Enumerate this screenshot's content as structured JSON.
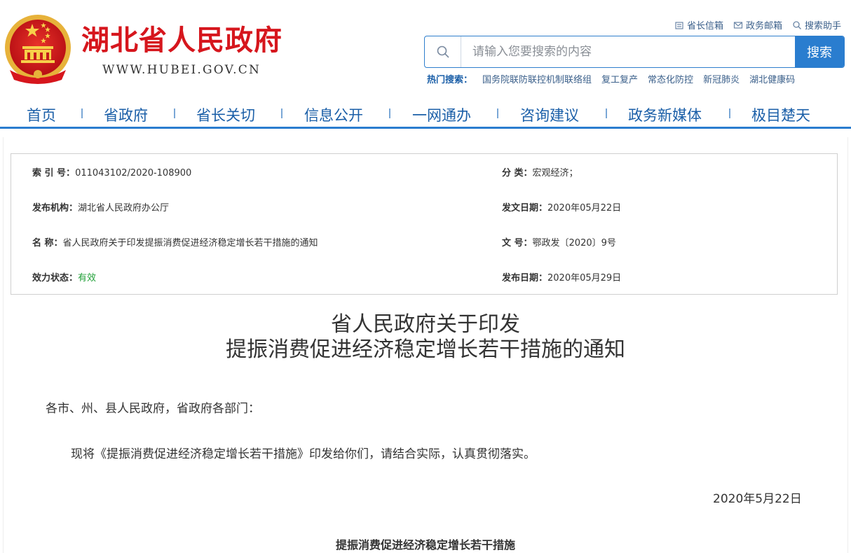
{
  "header": {
    "site_title": "湖北省人民政府",
    "site_url": "WWW.HUBEI.GOV.CN",
    "top_links": [
      {
        "label": "省长信箱",
        "icon": "mailbox-icon"
      },
      {
        "label": "政务邮箱",
        "icon": "envelope-icon"
      },
      {
        "label": "搜索助手",
        "icon": "search-icon"
      }
    ],
    "search": {
      "placeholder": "请输入您要搜索的内容",
      "button_label": "搜索"
    },
    "hot_search": {
      "label": "热门搜索：",
      "items": [
        "国务院联防联控机制联络组",
        "复工复产",
        "常态化防控",
        "新冠肺炎",
        "湖北健康码"
      ]
    }
  },
  "nav": {
    "items": [
      "首页",
      "省政府",
      "省长关切",
      "信息公开",
      "一网通办",
      "咨询建议",
      "政务新媒体",
      "极目楚天"
    ]
  },
  "meta": {
    "index_label": "索 引 号：",
    "index_value": "011043102/2020-108900",
    "category_label": "分 类：",
    "category_value": "宏观经济；",
    "issuer_label": "发布机构：",
    "issuer_value": "湖北省人民政府办公厅",
    "doc_date_label": "发文日期：",
    "doc_date_value": "2020年05月22日",
    "name_label": "名 称：",
    "name_value": "省人民政府关于印发提振消费促进经济稳定增长若干措施的通知",
    "doc_no_label": "文 号：",
    "doc_no_value": "鄂政发〔2020〕9号",
    "status_label": "效力状态：",
    "status_value": "有效",
    "pub_date_label": "发布日期：",
    "pub_date_value": "2020年05月29日"
  },
  "article": {
    "title_line1": "省人民政府关于印发",
    "title_line2": "提振消费促进经济稳定增长若干措施的通知",
    "salutation": "各市、州、县人民政府，省政府各部门：",
    "body": "现将《提振消费促进经济稳定增长若干措施》印发给你们，请结合实际，认真贯彻落实。",
    "date": "2020年5月22日",
    "subheading": "提振消费促进经济稳定增长若干措施"
  },
  "colors": {
    "brand_red": "#d6161d",
    "brand_blue": "#2a7dcf",
    "nav_text": "#1b5fa8",
    "status_green": "#21a038"
  }
}
